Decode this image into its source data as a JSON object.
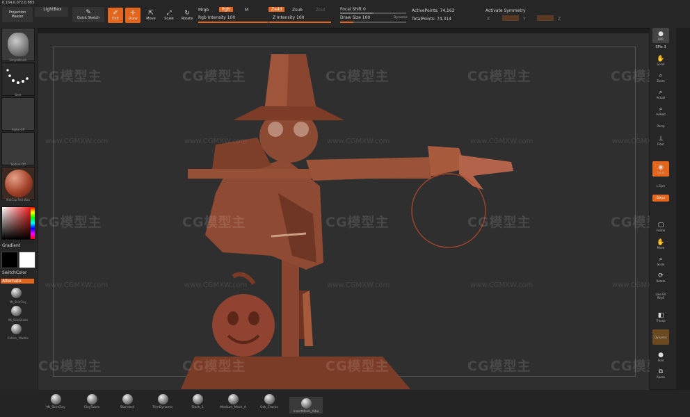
{
  "top": {
    "readout": "0.154,0.072,0.883",
    "projection_master": "Projection Master",
    "lightbox": "LightBox",
    "quick_sketch": "Quick Sketch",
    "edit": "Edit",
    "draw": "Draw",
    "move": "Move",
    "scale": "Scale",
    "rotate": "Rotate",
    "mrgb": "Mrgb",
    "rgb": "Rgb",
    "m": "M",
    "rgb_intensity": "Rgb Intensity 100",
    "zadd": "Zadd",
    "zsub": "Zsub",
    "zcut": "Zcut",
    "z_intensity": "Z Intensity 100",
    "focal_shift": "Focal Shift 0",
    "draw_size": "Draw Size 100",
    "dynamic": "Dynamic",
    "active_points": "ActivePoints: 74,162",
    "total_points": "TotalPoints: 74,314",
    "activate_symmetry": "Activate Symmetry",
    "sym_x": "X",
    "sym_y": "Y",
    "sym_z": "Z"
  },
  "left": {
    "thumb1": "SimpleBrush",
    "thumb2": "Dots",
    "thumb3": "Alpha Off",
    "thumb4": "Texture Off",
    "thumb5": "MatCap Red Wax",
    "gradient": "Gradient",
    "switch_color": "SwitchColor",
    "alternate": "Alternate",
    "mat1": "Mt_SkinClay",
    "mat2": "Mt_SkinShade",
    "mat3": "Enfore_ Marble"
  },
  "right": {
    "bpr": "BPR",
    "spix": "SPix 3",
    "scroll": "Scroll",
    "zoom": "Zoom",
    "actual": "Actual",
    "aahalf": "AAHalf",
    "persp": "Persp",
    "floor": "Floor",
    "local": "Local",
    "lsym": "L.Sym",
    "gxyz": "Gxyz",
    "frame": "Frame",
    "move": "Move",
    "scale": "Scale",
    "rotate": "Rotate",
    "linefill": "Line Fill",
    "polyf": "PolyF",
    "transp": "Transp",
    "dynamic": "Dynamic",
    "solo": "Solo",
    "xpose": "Xpose"
  },
  "bottom": {
    "brushes": [
      "Mt_SkinClay",
      "ClayTubes",
      "Standard",
      "TrimDynamic",
      "Slash_1",
      "Medium_Mech_A",
      "Orb_Cracks",
      "InsertMesh_Alba"
    ]
  },
  "watermark": {
    "logo": "CG模型主",
    "url": "www.CGMXW.com"
  },
  "colors": {
    "accent": "#e2661e",
    "model": "#8e4a33"
  }
}
